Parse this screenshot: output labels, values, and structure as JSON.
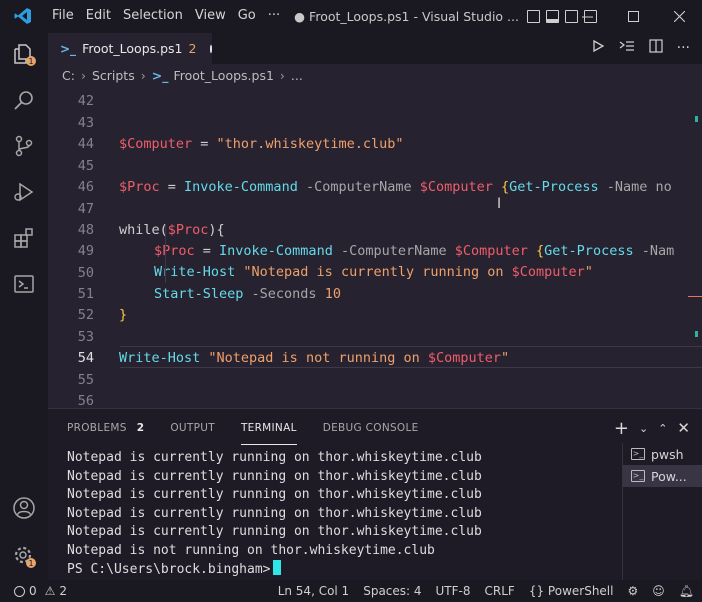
{
  "titlebar": {
    "menu": [
      "File",
      "Edit",
      "Selection",
      "View",
      "Go",
      "···"
    ],
    "title": "● Froot_Loops.ps1 - Visual Studio ...",
    "controls": [
      "minimize",
      "maximize",
      "close"
    ]
  },
  "tab": {
    "label": "Froot_Loops.ps1",
    "count": "2"
  },
  "breadcrumb": {
    "drive": "C:",
    "folder": "Scripts",
    "file": "Froot_Loops.ps1",
    "more": "..."
  },
  "code": {
    "lines": [
      {
        "num": "42"
      },
      {
        "num": "43"
      },
      {
        "num": "44"
      },
      {
        "num": "45"
      },
      {
        "num": "46"
      },
      {
        "num": "47"
      },
      {
        "num": "48"
      },
      {
        "num": "49"
      },
      {
        "num": "50"
      },
      {
        "num": "51"
      },
      {
        "num": "52"
      },
      {
        "num": "53"
      },
      {
        "num": "54"
      },
      {
        "num": "55"
      },
      {
        "num": "56"
      }
    ],
    "t43": {
      "var": "$Computer",
      "eq": " = ",
      "str": "\"thor.whiskeytime.club\""
    },
    "t45": {
      "var": "$Proc",
      "eq": " = ",
      "cmd": "Invoke-Command",
      "param": " -ComputerName ",
      "var2": "$Computer",
      "brace": " {",
      "cmd2": "Get-Process",
      "param2": " -Name no"
    },
    "t47": {
      "kw": "while(",
      "var": "$Proc",
      "kw2": "){"
    },
    "t48": {
      "var": "$Proc",
      "eq": " = ",
      "cmd": "Invoke-Command",
      "param": " -ComputerName ",
      "var2": "$Computer",
      "brace": " {",
      "cmd2": "Get-Process",
      "param2": " -Nam"
    },
    "t49": {
      "cmd": "Write-Host",
      "str": " \"Notepad is currently running on ",
      "var": "$Computer",
      "str2": "\""
    },
    "t50": {
      "cmd": "Start-Sleep",
      "param": " -Seconds ",
      "num": "10"
    },
    "t51": {
      "brace": "}"
    },
    "t53": {
      "cmd": "Write-Host",
      "str": " \"Notepad is not running on ",
      "var": "$Computer",
      "str2": "\""
    }
  },
  "panel": {
    "tabs": [
      "PROBLEMS",
      "OUTPUT",
      "TERMINAL",
      "DEBUG CONSOLE"
    ],
    "problems_count": "2",
    "active_tab": "TERMINAL"
  },
  "terminal": {
    "lines": [
      "Notepad is currently running on thor.whiskeytime.club",
      "Notepad is currently running on thor.whiskeytime.club",
      "Notepad is currently running on thor.whiskeytime.club",
      "Notepad is currently running on thor.whiskeytime.club",
      "Notepad is currently running on thor.whiskeytime.club",
      "Notepad is not running on thor.whiskeytime.club"
    ],
    "prompt": "PS C:\\Users\\brock.bingham>",
    "instances": [
      "pwsh",
      "Pow..."
    ]
  },
  "status": {
    "errors": "0",
    "warnings": "2",
    "position": "Ln 54, Col 1",
    "spaces": "Spaces: 4",
    "encoding": "UTF-8",
    "eol": "CRLF",
    "language": "PowerShell"
  },
  "colors": {
    "accent": "#2ee6e6",
    "background": "#262230",
    "badge": "#e6a56a"
  }
}
